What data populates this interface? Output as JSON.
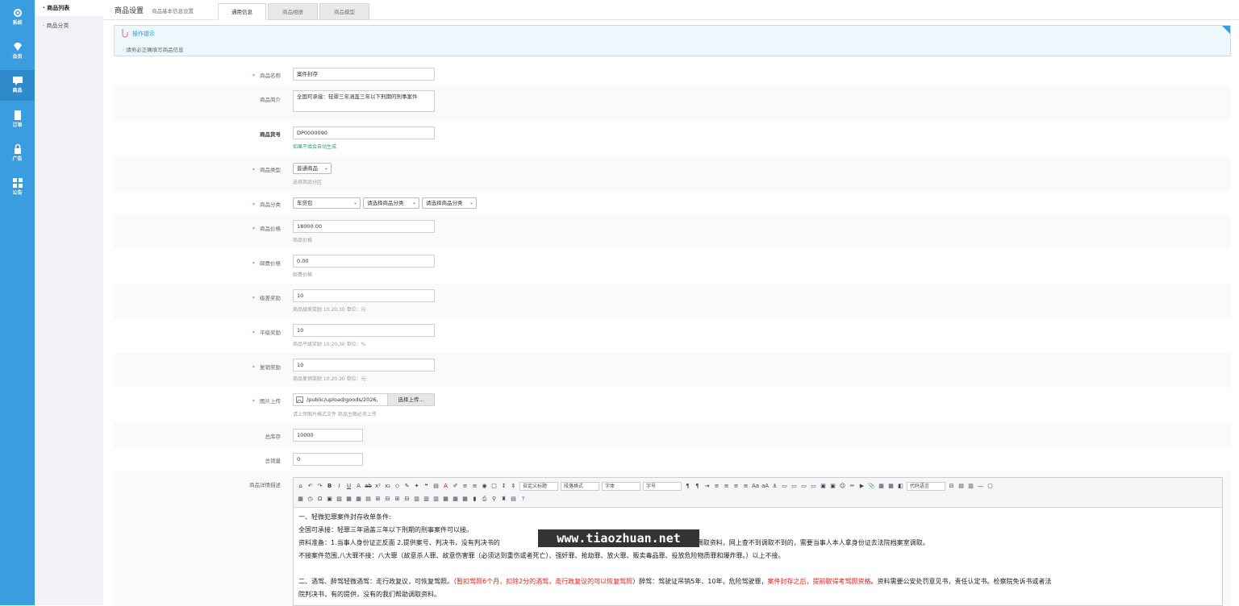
{
  "sidebar": {
    "items": [
      {
        "label": "系统",
        "icon": "gear-icon"
      },
      {
        "label": "会员",
        "icon": "diamond-icon"
      },
      {
        "label": "商品",
        "icon": "chat-icon"
      },
      {
        "label": "订单",
        "icon": "document-icon"
      },
      {
        "label": "广告",
        "icon": "lock-icon"
      },
      {
        "label": "公告",
        "icon": "grid-icon"
      }
    ],
    "active": "商品"
  },
  "submenu": {
    "items": [
      "商品列表",
      "商品分类"
    ]
  },
  "header": {
    "title": "商品设置",
    "subtitle": "商品基本信息设置",
    "tabs": [
      "通用信息",
      "商品相册",
      "商品模型"
    ]
  },
  "tips": {
    "title": "操作提示",
    "text": "请务必正确填写商品信息"
  },
  "form": {
    "name": {
      "label": "商品名称",
      "value": "案件封存"
    },
    "intro": {
      "label": "商品简介",
      "value": "全国可承接：轻罪三年涵盖三年以下刑期的刑事案件"
    },
    "sku": {
      "label": "商品货号",
      "value": "DP0000090",
      "hint": "如果不填会自动生成"
    },
    "type": {
      "label": "商品类型",
      "value": "普通商品",
      "hint": "选择商品分区"
    },
    "category": {
      "label": "商品分类",
      "values": [
        "车贷包",
        "请选择商品分类",
        "请选择商品分类"
      ]
    },
    "price": {
      "label": "商品价格",
      "value": "18000.00",
      "hint": "商品价格"
    },
    "shipping": {
      "label": "邮费价格",
      "value": "0.00",
      "hint": "邮费价格"
    },
    "level_reward": {
      "label": "级差奖励",
      "value": "10",
      "hint": "商品级差奖励 10,20,30 单位：元"
    },
    "flat_reward": {
      "label": "平级奖励",
      "value": "10",
      "hint": "商品平级奖励 10,20,30 单位：%"
    },
    "rebuy_reward": {
      "label": "复销奖励",
      "value": "10",
      "hint": "商品复销奖励 10,20,30 单位：元"
    },
    "image": {
      "label": "图片上传",
      "value": "/public/upload/goods/2026,",
      "button": "选择上传...",
      "hint": "请上传图片格式文件 商品主图必须上传"
    },
    "stock": {
      "label": "总库存",
      "value": "10000"
    },
    "sales": {
      "label": "总销量",
      "value": "0"
    },
    "detail": {
      "label": "商品详情描述"
    }
  },
  "editor": {
    "selects": [
      "自定义标题",
      "段落格式",
      "字体",
      "字号",
      "代码语言"
    ],
    "lines": [
      "一、轻微犯罪案件封存收单条件:",
      "全国可承接：轻罪三年涵盖三年以下刑期的刑事案件可以接。",
      "资料准备：1.当事人身份证正反面  2.提供案号、判决书，没有判决书的",
      "们可以调取资料，网上查不到调取不到的，需要当事人本人拿身份证去法院档案室调取。",
      "不接案件范围,八大罪不接：八大罪（故意杀人罪、故意伤害罪（必须达到重伤或者死亡）、强奸罪、抢劫罪、放火罪、贩卖毒品罪、投放危险物质罪和爆炸罪。）以上不接。",
      "二、酒驾、醉驾轻微酒驾：走行政复议，可恢复驾照。（",
      "暂扣驾照6个月，扣除2分的酒驾，走行政复议的可以恢复驾照",
      "）醉驾：驾驶证吊销5年、10年，危险驾驶罪，",
      "案件封存之后，提前取得考驾照资格",
      "。资料需要公安处罚意见书，责任认定书。检察院免诉书或者法",
      "院判决书，有的提供，没有的我们帮助调取资料。"
    ]
  },
  "watermark": "www.tiaozhuan.net"
}
